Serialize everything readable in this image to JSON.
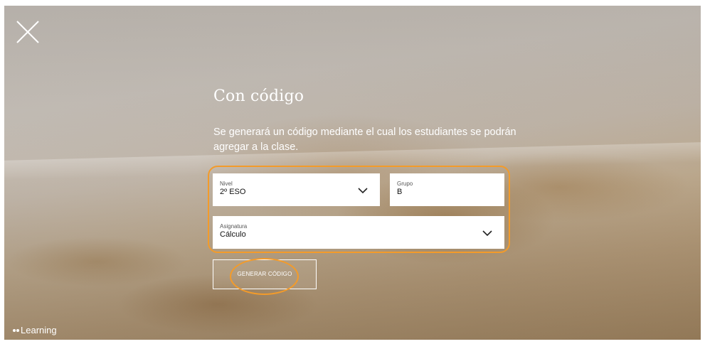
{
  "overlay": {
    "title": "Con código",
    "description": "Se generará un código mediante el cual los estudiantes se podrán agregar a la clase."
  },
  "form": {
    "nivel": {
      "label": "Nivel",
      "value": "2º ESO"
    },
    "grupo": {
      "label": "Grupo",
      "value": "B"
    },
    "asignatura": {
      "label": "Asignatura",
      "value": "Cálculo"
    },
    "generate_button": "GENERAR CÓDIGO"
  },
  "brand": {
    "name": "Learning"
  },
  "icons": {
    "close": "close-icon",
    "dropdown": "chevron-down-icon",
    "brand": "logo-dots-icon"
  },
  "colors": {
    "highlight": "#f39b2a",
    "text": "#ffffff",
    "field_background": "#ffffff"
  }
}
